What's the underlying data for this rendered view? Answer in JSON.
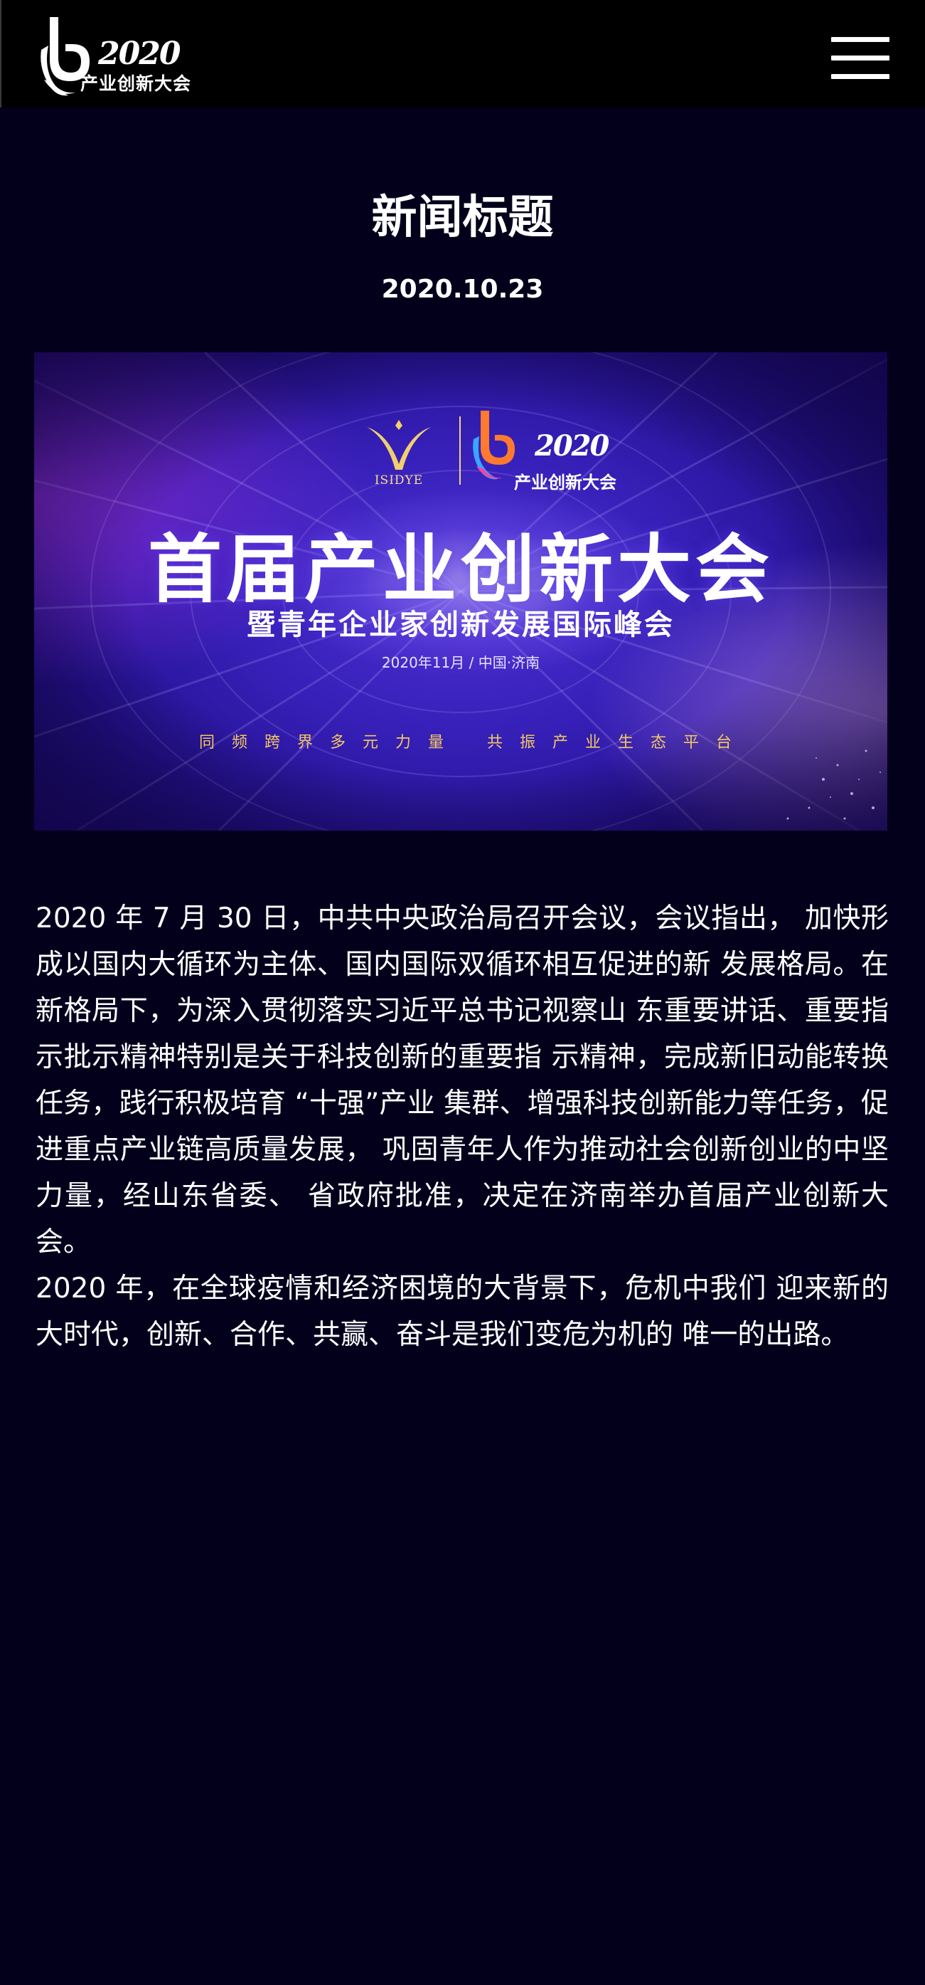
{
  "header": {
    "logo_year": "2020",
    "logo_subtitle": "产业创新大会",
    "menu_icon": "hamburger-menu-icon"
  },
  "news": {
    "title": "新闻标题",
    "date": "2020.10.23"
  },
  "banner": {
    "isidye_label": "ISIDYE",
    "logo_year": "2020",
    "logo_subtitle": "产业创新大会",
    "main_title": "首届产业创新大会",
    "subtitle": "暨青年企业家创新发展国际峰会",
    "info": "2020年11月  / 中国·济南",
    "slogan_left": "同频跨界多元力量",
    "slogan_right": "共振产业生态平台",
    "colors": {
      "deep": "#180868",
      "core": "#4f2fd6",
      "gold": "#f4c862"
    }
  },
  "article": {
    "paragraphs": [
      "2020 年 7 月 30 日，中共中央政治局召开会议，会议指出， 加快形成以国内大循环为主体、国内国际双循环相互促进的新 发展格局。在新格局下，为深入贯彻落实习近平总书记视察山 东重要讲话、重要指示批示精神特别是关于科技创新的重要指 示精神，完成新旧动能转换任务，践行积极培育 “十强”产业 集群、增强科技创新能力等任务，促进重点产业链高质量发展， 巩固青年人作为推动社会创新创业的中坚力量，经山东省委、 省政府批准，决定在济南举办首届产业创新大会。",
      "2020 年，在全球疫情和经济困境的大背景下，危机中我们 迎来新的大时代，创新、合作、共赢、奋斗是我们变危为机的 唯一的出路。"
    ]
  },
  "colors": {
    "page_background": "#03001c",
    "header_background": "#000000",
    "text": "#ffffff"
  }
}
